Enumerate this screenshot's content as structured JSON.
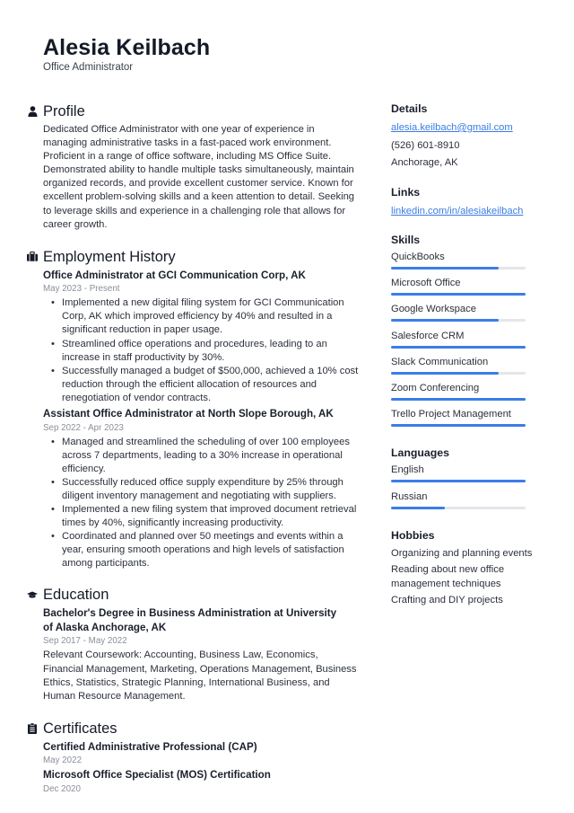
{
  "header": {
    "name": "Alesia Keilbach",
    "title": "Office Administrator"
  },
  "profile": {
    "heading": "Profile",
    "icon": "user-icon",
    "text": "Dedicated Office Administrator with one year of experience in managing administrative tasks in a fast-paced work environment. Proficient in a range of office software, including MS Office Suite. Demonstrated ability to handle multiple tasks simultaneously, maintain organized records, and provide excellent customer service. Known for excellent problem-solving skills and a keen attention to detail. Seeking to leverage skills and experience in a challenging role that allows for career growth."
  },
  "employment": {
    "heading": "Employment History",
    "icon": "briefcase-icon",
    "jobs": [
      {
        "title": "Office Administrator at GCI Communication Corp, AK",
        "dates": "May 2023 - Present",
        "bullets": [
          "Implemented a new digital filing system for GCI Communication Corp, AK which improved efficiency by 40% and resulted in a significant reduction in paper usage.",
          "Streamlined office operations and procedures, leading to an increase in staff productivity by 30%.",
          "Successfully managed a budget of $500,000, achieved a 10% cost reduction through the efficient allocation of resources and renegotiation of vendor contracts."
        ]
      },
      {
        "title": "Assistant Office Administrator at North Slope Borough, AK",
        "dates": "Sep 2022 - Apr 2023",
        "bullets": [
          "Managed and streamlined the scheduling of over 100 employees across 7 departments, leading to a 30% increase in operational efficiency.",
          "Successfully reduced office supply expenditure by 25% through diligent inventory management and negotiating with suppliers.",
          "Implemented a new filing system that improved document retrieval times by 40%, significantly increasing productivity.",
          "Coordinated and planned over 50 meetings and events within a year, ensuring smooth operations and high levels of satisfaction among participants."
        ]
      }
    ]
  },
  "education": {
    "heading": "Education",
    "icon": "graduation-cap-icon",
    "items": [
      {
        "title": "Bachelor's Degree in Business Administration at University of Alaska Anchorage, AK",
        "dates": "Sep 2017 - May 2022",
        "description": "Relevant Coursework: Accounting, Business Law, Economics, Financial Management, Marketing, Operations Management, Business Ethics, Statistics, Strategic Planning, International Business, and Human Resource Management."
      }
    ]
  },
  "certificates": {
    "heading": "Certificates",
    "icon": "clipboard-icon",
    "items": [
      {
        "title": "Certified Administrative Professional (CAP)",
        "date": "May 2022"
      },
      {
        "title": "Microsoft Office Specialist (MOS) Certification",
        "date": "Dec 2020"
      }
    ]
  },
  "details": {
    "heading": "Details",
    "email": "alesia.keilbach@gmail.com",
    "phone": "(526) 601-8910",
    "location": "Anchorage, AK"
  },
  "links": {
    "heading": "Links",
    "items": [
      "linkedin.com/in/alesiakeilbach"
    ]
  },
  "skills": {
    "heading": "Skills",
    "items": [
      {
        "name": "QuickBooks",
        "level": 0.8
      },
      {
        "name": "Microsoft Office",
        "level": 1.0
      },
      {
        "name": "Google Workspace",
        "level": 0.8
      },
      {
        "name": "Salesforce CRM",
        "level": 1.0
      },
      {
        "name": "Slack Communication",
        "level": 0.8
      },
      {
        "name": "Zoom Conferencing",
        "level": 1.0
      },
      {
        "name": "Trello Project Management",
        "level": 1.0
      }
    ]
  },
  "languages": {
    "heading": "Languages",
    "items": [
      {
        "name": "English",
        "level": 1.0
      },
      {
        "name": "Russian",
        "level": 0.4
      }
    ]
  },
  "hobbies": {
    "heading": "Hobbies",
    "items": [
      "Organizing and planning events",
      "Reading about new office management techniques",
      "Crafting and DIY projects"
    ]
  },
  "colors": {
    "accent": "#3b7de8",
    "link": "#3b7de0",
    "track": "#e4e6ea",
    "text": "#2b303b",
    "muted": "#8a8f98"
  }
}
